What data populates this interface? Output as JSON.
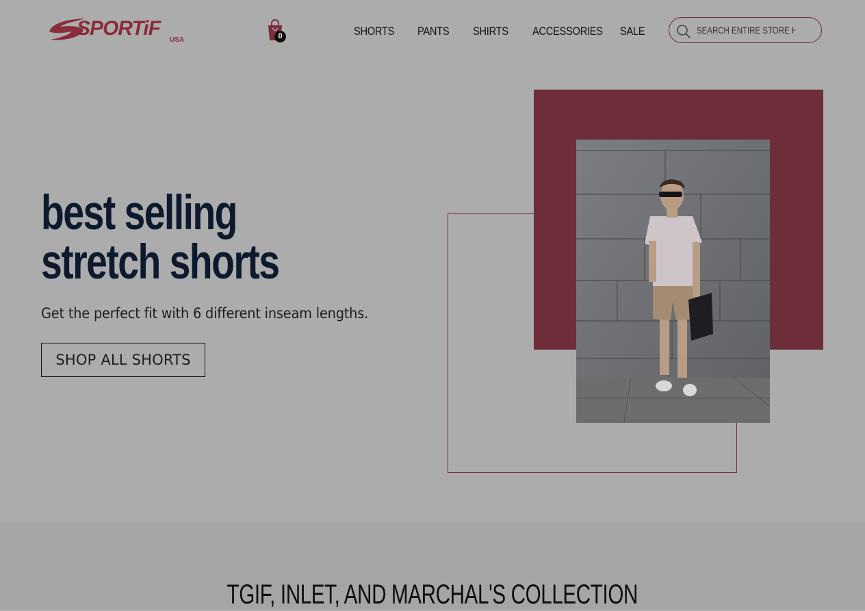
{
  "header": {
    "logo": {
      "text": "SPORTiF",
      "sub": "USA"
    },
    "cart": {
      "count": "0"
    },
    "nav": [
      "SHORTS",
      "PANTS",
      "SHIRTS",
      "ACCESSORIES",
      "SALE"
    ],
    "search": {
      "placeholder": "SEARCH ENTIRE STORE HERE"
    }
  },
  "hero": {
    "title_line1": "best selling",
    "title_line2": "stretch shorts",
    "subtitle": "Get the perfect fit with 6 different inseam lengths.",
    "button": "SHOP ALL SHORTS"
  },
  "collection": {
    "title": "TGIF, INLET, AND MARCHAL'S COLLECTION"
  },
  "colors": {
    "brand": "#8a2c3a",
    "accent_block": "#6e2e39",
    "overlay_bg": "#acacac",
    "heading": "#0d1a2e"
  }
}
